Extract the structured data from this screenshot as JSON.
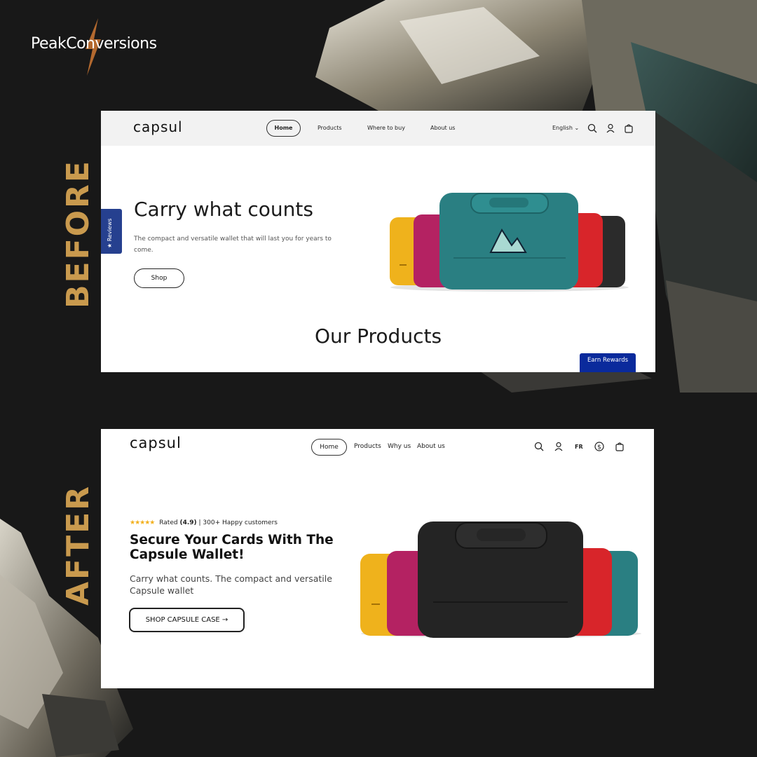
{
  "brand": {
    "name": "PeakConversions"
  },
  "labels": {
    "before": "BEFORE",
    "after": "AFTER"
  },
  "colors": {
    "background": "#181818",
    "accent_gold": "#c99a4e",
    "bolt": "#b3692f",
    "rewards_blue": "#0a2a9c",
    "reviews_blue": "#26408f"
  },
  "before": {
    "logo": "capsul",
    "nav": {
      "home": "Home",
      "products": "Products",
      "where": "Where to buy",
      "about": "About us",
      "language": "English"
    },
    "icons": [
      "search-icon",
      "account-icon",
      "cart-icon"
    ],
    "reviews_tab": "Reviews",
    "hero": {
      "title": "Carry what counts",
      "subtitle": "The compact and versatile wallet that will last you for years to come.",
      "button": "Shop"
    },
    "section_title": "Our Products",
    "rewards_button": "Earn Rewards"
  },
  "after": {
    "logo": "capsul",
    "nav": {
      "home": "Home",
      "products": "Products",
      "why": "Why us",
      "about": "About us",
      "lang": "FR"
    },
    "icons": [
      "search-icon",
      "account-icon",
      "currency-icon",
      "cart-icon"
    ],
    "rating": {
      "stars": 5,
      "rated_label": "Rated",
      "score": "(4.9)",
      "customers": "300+ Happy customers"
    },
    "hero": {
      "title_line1": "Secure Your Cards With The",
      "title_line2": "Capsule Wallet!",
      "subtitle_line1": "Carry what counts. The compact and versatile",
      "subtitle_line2": "Capsule wallet",
      "button": "SHOP CAPSULE CASE →"
    }
  }
}
